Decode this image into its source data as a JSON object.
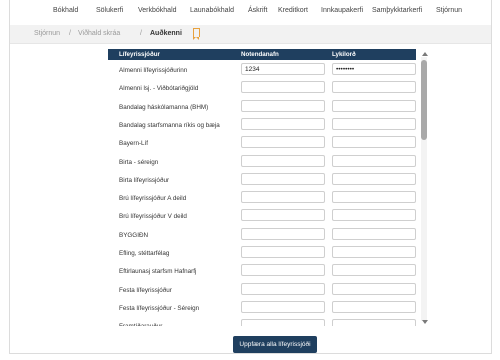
{
  "nav": {
    "items": [
      "Bókhald",
      "Sölukerfi",
      "Verkbókhald",
      "Launabókhald",
      "Áskrift",
      "Kreditkort",
      "Innkaupakerfi",
      "Samþykktarkerfi",
      "Stjórnun"
    ]
  },
  "breadcrumb": {
    "items": [
      "Stjórnun",
      "Viðhald skráa",
      "Auðkenni"
    ]
  },
  "table": {
    "headers": {
      "fund": "Lífeyrissjóður",
      "user": "Notendanafn",
      "password": "Lykilorð"
    },
    "rows": [
      {
        "fund": "Almenni lífeyrissjóðurinn",
        "user": "1234",
        "password": "••••••••"
      },
      {
        "fund": "Almenni lsj. - Viðbótariðgjöld",
        "user": "",
        "password": ""
      },
      {
        "fund": "Bandalag háskólamanna (BHM)",
        "user": "",
        "password": ""
      },
      {
        "fund": "Bandalag starfsmanna ríkis og bæja",
        "user": "",
        "password": ""
      },
      {
        "fund": "Bayern-Líf",
        "user": "",
        "password": ""
      },
      {
        "fund": "Birta - séreign",
        "user": "",
        "password": ""
      },
      {
        "fund": "Birta lífeyrissjóður",
        "user": "",
        "password": ""
      },
      {
        "fund": "Brú lífeyrissjóður A deild",
        "user": "",
        "password": ""
      },
      {
        "fund": "Brú lífeyrissjóður V deild",
        "user": "",
        "password": ""
      },
      {
        "fund": "BYGGIÐN",
        "user": "",
        "password": ""
      },
      {
        "fund": "Efling, stéttarfélag",
        "user": "",
        "password": ""
      },
      {
        "fund": "Eftirlaunasj starfsm Hafnarfj",
        "user": "",
        "password": ""
      },
      {
        "fund": "Festa lífeyrissjóður",
        "user": "",
        "password": ""
      },
      {
        "fund": "Festa lífeyrissjóður - Séreign",
        "user": "",
        "password": ""
      },
      {
        "fund": "Framtíðarauður",
        "user": "",
        "password": ""
      }
    ]
  },
  "actions": {
    "update_all": "Uppfæra alla lífeyrissjóði"
  },
  "colors": {
    "header_bg": "#1f3f5f",
    "bookmark": "#e8a13c"
  },
  "icons": {
    "bookmark": "bookmark-icon",
    "scroll_up": "arrow-up-icon",
    "scroll_down": "arrow-down-icon"
  }
}
